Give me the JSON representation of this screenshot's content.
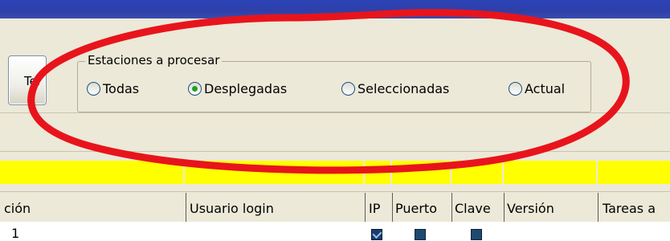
{
  "toolbar": {
    "tel_label": "Tel"
  },
  "group": {
    "legend": "Estaciones a procesar",
    "options": [
      {
        "label": "Todas",
        "selected": false
      },
      {
        "label": "Desplegadas",
        "selected": true
      },
      {
        "label": "Seleccionadas",
        "selected": false
      },
      {
        "label": "Actual",
        "selected": false
      }
    ]
  },
  "table": {
    "columns": [
      "ción",
      "Usuario login",
      "IP",
      "Puerto",
      "Clave",
      "Versión",
      "Tareas a"
    ],
    "row1": {
      "first_cell": "1",
      "ip_checked": true,
      "puerto_checked": true,
      "clave_checked": true
    }
  },
  "colors": {
    "annotation": "#e8141c",
    "filter_strip": "#ffff00",
    "selected_dot": "#21a121"
  }
}
